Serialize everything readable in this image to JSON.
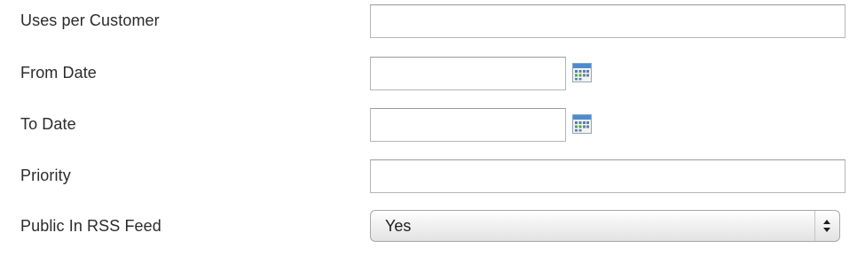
{
  "fields": {
    "uses_per_customer": {
      "label": "Uses per Customer",
      "value": ""
    },
    "from_date": {
      "label": "From Date",
      "value": "",
      "calendar_icon": "calendar-icon"
    },
    "to_date": {
      "label": "To Date",
      "value": "",
      "calendar_icon": "calendar-icon"
    },
    "priority": {
      "label": "Priority",
      "value": ""
    },
    "public_in_rss_feed": {
      "label": "Public In RSS Feed",
      "selected": "Yes",
      "arrows_icon": "select-arrows-icon"
    }
  },
  "colors": {
    "label_text": "#2b2b2b",
    "input_border": "#b5b5b5",
    "calendar_blue": "#4d8bd0",
    "calendar_green": "#4aa84a"
  }
}
